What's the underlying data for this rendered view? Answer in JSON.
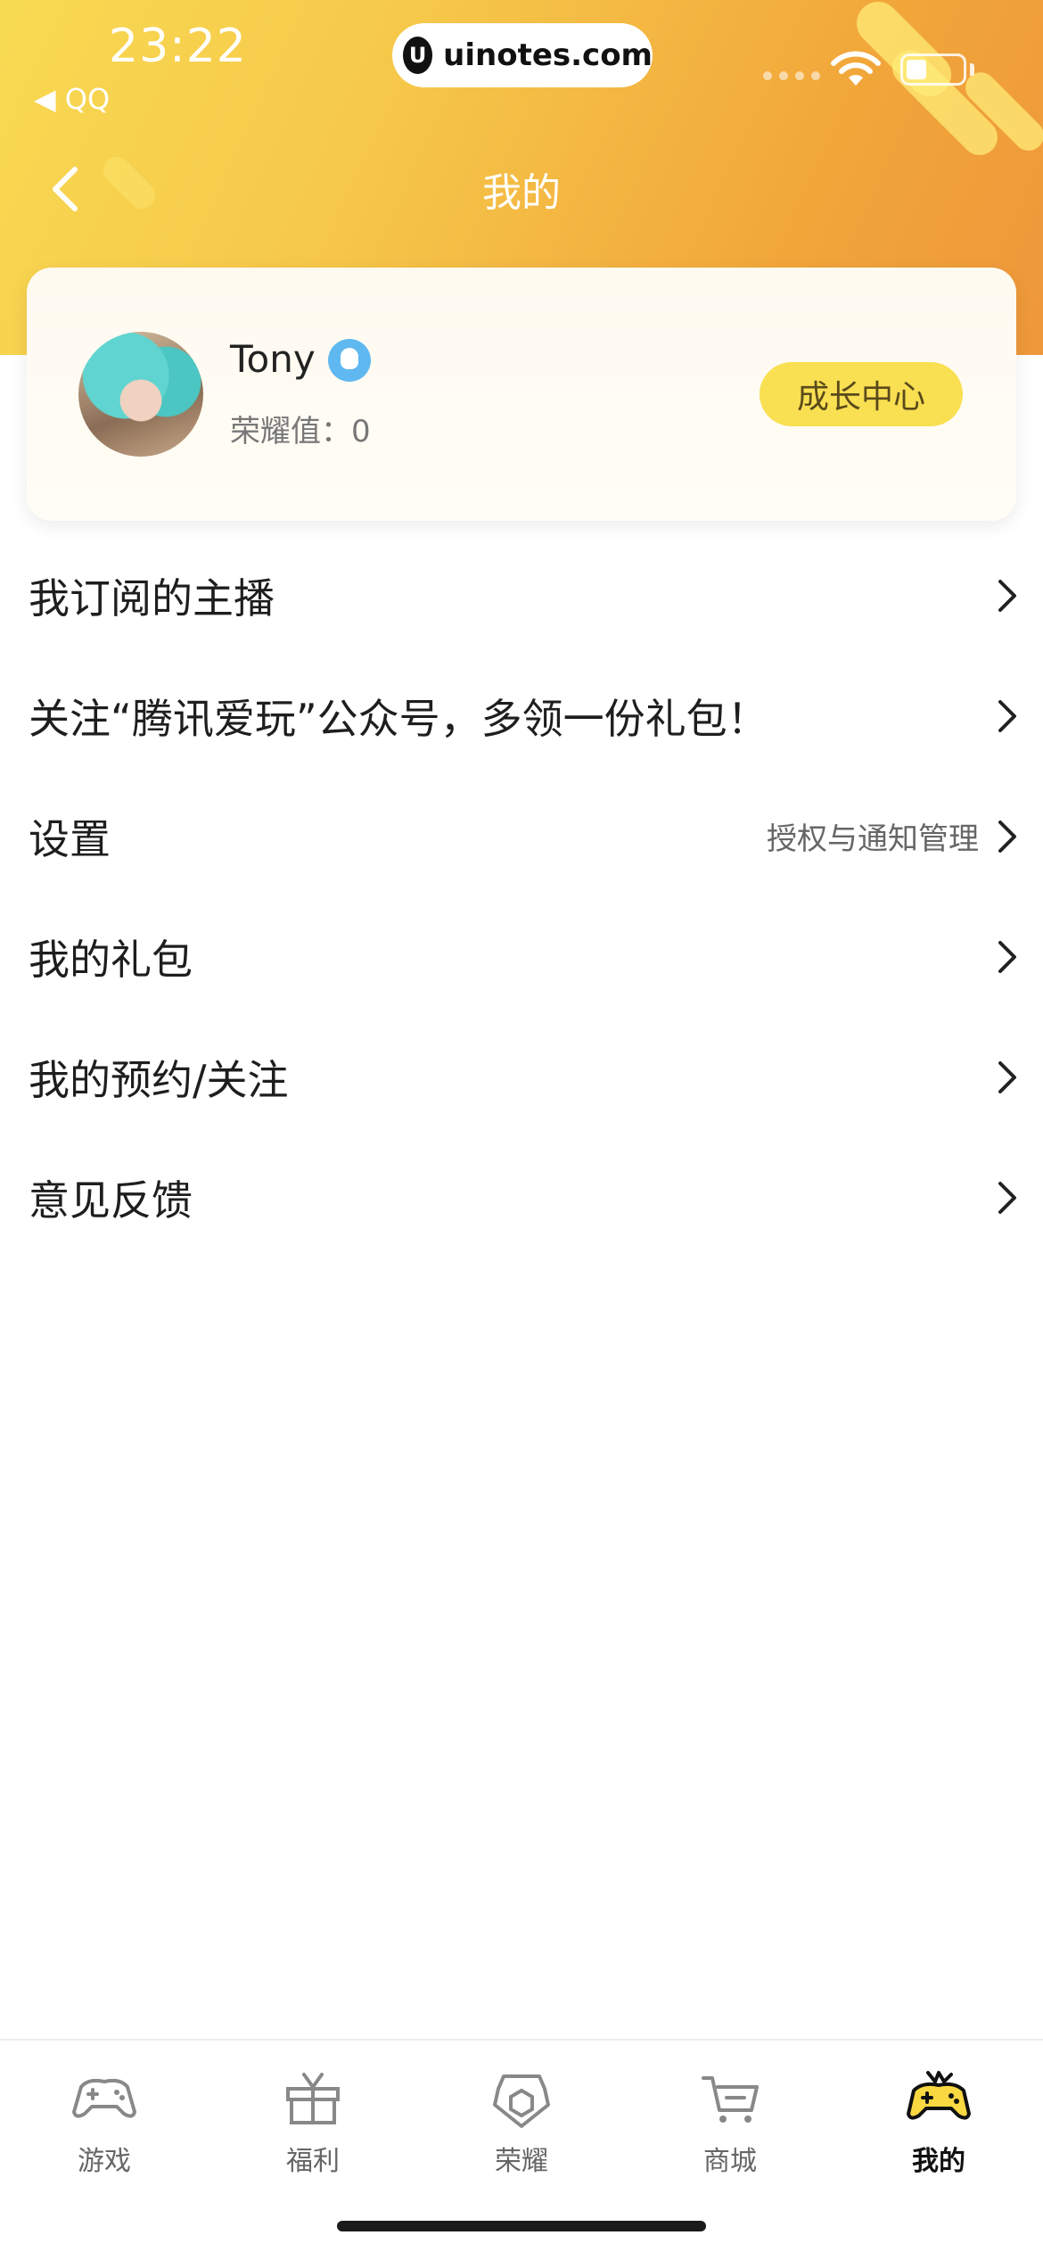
{
  "status_bar": {
    "time": "23:22",
    "back_app": "◀ QQ",
    "url": "uinotes.com"
  },
  "nav": {
    "title": "我的"
  },
  "profile": {
    "name": "Tony",
    "honor_label": "荣耀值：",
    "honor_value": "0",
    "growth_button": "成长中心"
  },
  "menu": [
    {
      "label": "我订阅的主播",
      "sub": ""
    },
    {
      "label": "关注“腾讯爱玩”公众号，多领一份礼包！",
      "sub": ""
    },
    {
      "label": "设置",
      "sub": "授权与通知管理"
    },
    {
      "label": "我的礼包",
      "sub": ""
    },
    {
      "label": "我的预约/关注",
      "sub": ""
    },
    {
      "label": "意见反馈",
      "sub": ""
    }
  ],
  "tabbar": [
    {
      "label": "游戏",
      "icon": "gamepad-icon"
    },
    {
      "label": "福利",
      "icon": "gift-icon"
    },
    {
      "label": "荣耀",
      "icon": "honor-badge-icon"
    },
    {
      "label": "商城",
      "icon": "cart-icon"
    },
    {
      "label": "我的",
      "icon": "mine-gamepad-icon",
      "active": true
    }
  ],
  "colors": {
    "header_start": "#f8da52",
    "header_end": "#ee973a",
    "growth_button": "#f9df52",
    "qq_badge": "#5fb8f0"
  }
}
